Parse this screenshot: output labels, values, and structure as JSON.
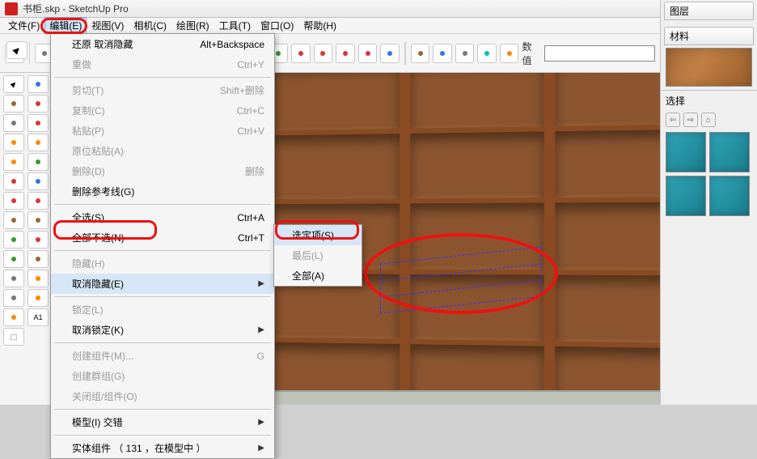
{
  "titlebar": {
    "title": "书柜.skp - SketchUp Pro"
  },
  "menubar": {
    "file": "文件(F)",
    "edit": "编辑(E)",
    "view": "视图(V)",
    "camera": "相机(C)",
    "draw": "绘图(R)",
    "tools": "工具(T)",
    "window": "窗口(O)",
    "help": "帮助(H)"
  },
  "toolbar": {
    "value_label": "数值"
  },
  "edit_menu": {
    "undo": {
      "label": "还原 取消隐藏",
      "accel": "Alt+Backspace"
    },
    "redo": {
      "label": "重做",
      "accel": "Ctrl+Y"
    },
    "cut": {
      "label": "剪切(T)",
      "accel": "Shift+删除"
    },
    "copy": {
      "label": "复制(C)",
      "accel": "Ctrl+C"
    },
    "paste": {
      "label": "粘贴(P)",
      "accel": "Ctrl+V"
    },
    "paste_in_place": {
      "label": "原位粘贴(A)"
    },
    "delete": {
      "label": "删除(D)",
      "accel": "删除"
    },
    "delete_guides": {
      "label": "删除参考线(G)"
    },
    "select_all": {
      "label": "全选(S)",
      "accel": "Ctrl+A"
    },
    "select_none": {
      "label": "全部不选(N)",
      "accel": "Ctrl+T"
    },
    "hide": {
      "label": "隐藏(H)"
    },
    "unhide": {
      "label": "取消隐藏(E)"
    },
    "lock": {
      "label": "锁定(L)"
    },
    "unlock": {
      "label": "取消锁定(K)"
    },
    "make_component": {
      "label": "创建组件(M)...",
      "accel": "G"
    },
    "make_group": {
      "label": "创建群组(G)"
    },
    "close_group": {
      "label": "关闭组/组件(O)"
    },
    "intersect": {
      "label": "模型(I) 交错"
    },
    "solid": {
      "label": "实体组件  （ 131 ，在模型中 ）"
    }
  },
  "unhide_submenu": {
    "selected": "选定项(S)",
    "last": "最后(L)",
    "all": "全部(A)"
  },
  "right_panel": {
    "layers_tab": "图层",
    "materials_tab": "材料",
    "select_label": "选择"
  }
}
